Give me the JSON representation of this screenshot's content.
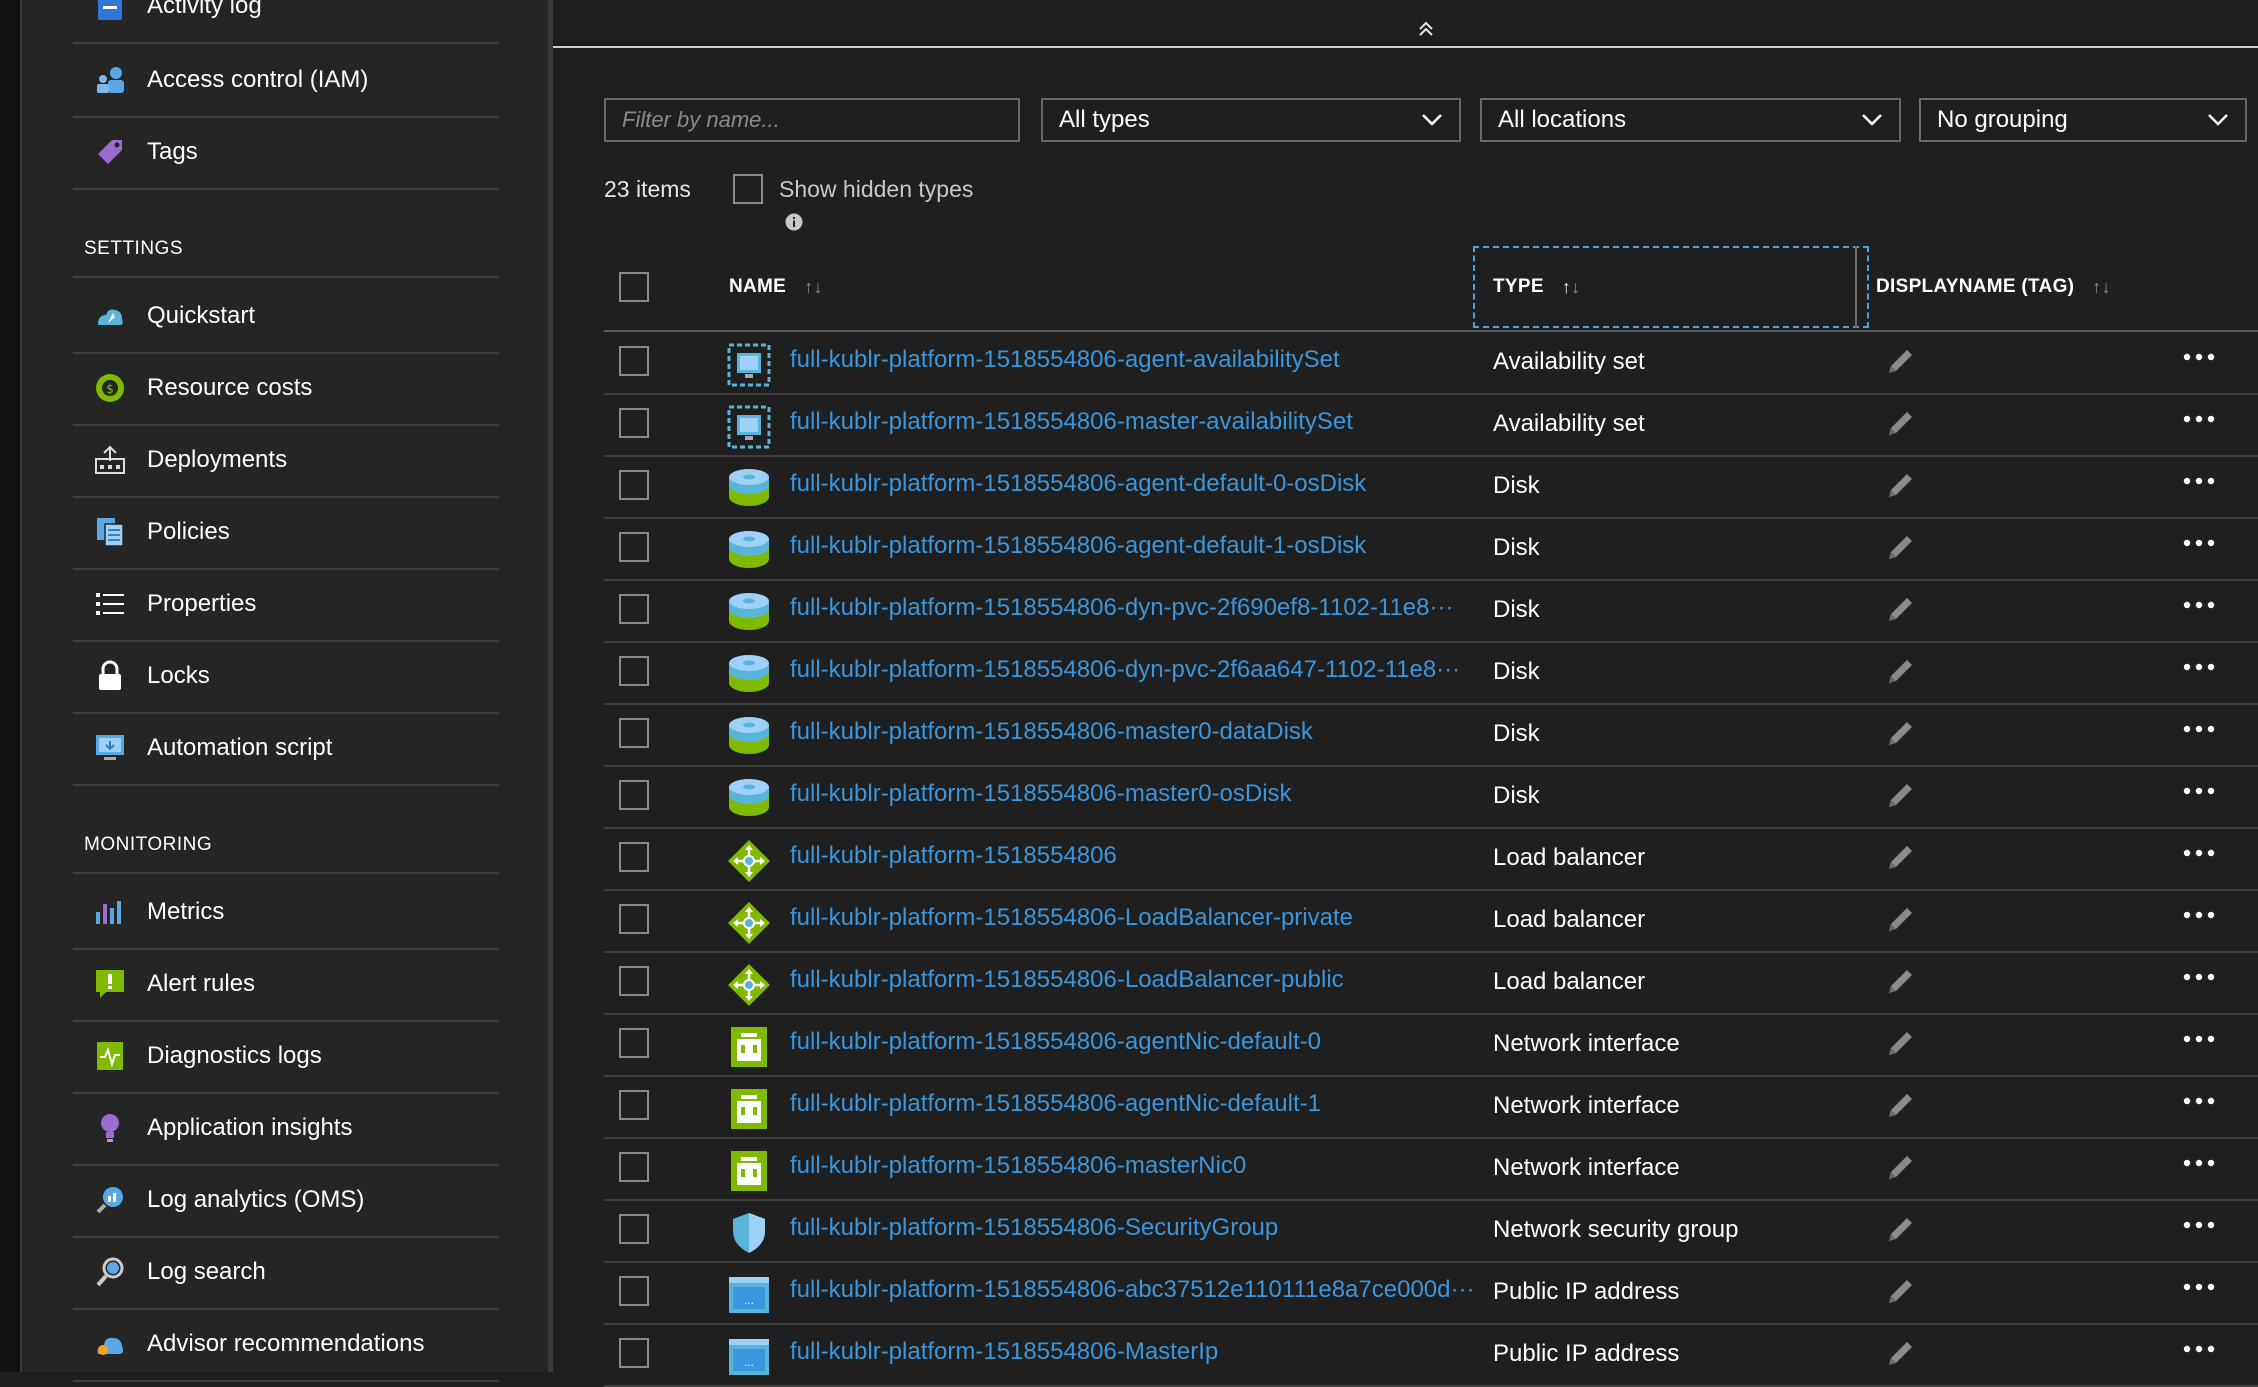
{
  "sidebar": {
    "items_top": [
      {
        "label": "Activity log",
        "icon": "activity-log-icon"
      },
      {
        "label": "Access control (IAM)",
        "icon": "access-control-icon"
      },
      {
        "label": "Tags",
        "icon": "tag-icon"
      }
    ],
    "settings_heading": "SETTINGS",
    "settings_items": [
      {
        "label": "Quickstart",
        "icon": "quickstart-icon"
      },
      {
        "label": "Resource costs",
        "icon": "resource-costs-icon"
      },
      {
        "label": "Deployments",
        "icon": "deployments-icon"
      },
      {
        "label": "Policies",
        "icon": "policies-icon"
      },
      {
        "label": "Properties",
        "icon": "properties-icon"
      },
      {
        "label": "Locks",
        "icon": "lock-icon"
      },
      {
        "label": "Automation script",
        "icon": "automation-script-icon"
      }
    ],
    "monitoring_heading": "MONITORING",
    "monitoring_items": [
      {
        "label": "Metrics",
        "icon": "metrics-icon"
      },
      {
        "label": "Alert rules",
        "icon": "alert-rules-icon"
      },
      {
        "label": "Diagnostics logs",
        "icon": "diagnostics-logs-icon"
      },
      {
        "label": "Application insights",
        "icon": "application-insights-icon"
      },
      {
        "label": "Log analytics (OMS)",
        "icon": "log-analytics-icon"
      },
      {
        "label": "Log search",
        "icon": "log-search-icon"
      },
      {
        "label": "Advisor recommendations",
        "icon": "advisor-icon"
      }
    ]
  },
  "filters": {
    "name_placeholder": "Filter by name...",
    "types": "All types",
    "locations": "All locations",
    "grouping": "No grouping"
  },
  "summary": {
    "count": "23 items",
    "show_hidden_label": "Show hidden types"
  },
  "table": {
    "columns": {
      "name": "NAME",
      "type": "TYPE",
      "displayname": "DISPLAYNAME (TAG)"
    },
    "rows": [
      {
        "name": "full-kublr-platform-1518554806-agent-availabilitySet",
        "type": "Availability set",
        "icon": "availability-set-icon"
      },
      {
        "name": "full-kublr-platform-1518554806-master-availabilitySet",
        "type": "Availability set",
        "icon": "availability-set-icon"
      },
      {
        "name": "full-kublr-platform-1518554806-agent-default-0-osDisk",
        "type": "Disk",
        "icon": "disk-icon"
      },
      {
        "name": "full-kublr-platform-1518554806-agent-default-1-osDisk",
        "type": "Disk",
        "icon": "disk-icon"
      },
      {
        "name": "full-kublr-platform-1518554806-dyn-pvc-2f690ef8-1102-11e8···",
        "type": "Disk",
        "icon": "disk-icon"
      },
      {
        "name": "full-kublr-platform-1518554806-dyn-pvc-2f6aa647-1102-11e8···",
        "type": "Disk",
        "icon": "disk-icon"
      },
      {
        "name": "full-kublr-platform-1518554806-master0-dataDisk",
        "type": "Disk",
        "icon": "disk-icon"
      },
      {
        "name": "full-kublr-platform-1518554806-master0-osDisk",
        "type": "Disk",
        "icon": "disk-icon"
      },
      {
        "name": "full-kublr-platform-1518554806",
        "type": "Load balancer",
        "icon": "load-balancer-icon"
      },
      {
        "name": "full-kublr-platform-1518554806-LoadBalancer-private",
        "type": "Load balancer",
        "icon": "load-balancer-icon"
      },
      {
        "name": "full-kublr-platform-1518554806-LoadBalancer-public",
        "type": "Load balancer",
        "icon": "load-balancer-icon"
      },
      {
        "name": "full-kublr-platform-1518554806-agentNic-default-0",
        "type": "Network interface",
        "icon": "network-interface-icon"
      },
      {
        "name": "full-kublr-platform-1518554806-agentNic-default-1",
        "type": "Network interface",
        "icon": "network-interface-icon"
      },
      {
        "name": "full-kublr-platform-1518554806-masterNic0",
        "type": "Network interface",
        "icon": "network-interface-icon"
      },
      {
        "name": "full-kublr-platform-1518554806-SecurityGroup",
        "type": "Network security group",
        "icon": "security-group-icon"
      },
      {
        "name": "full-kublr-platform-1518554806-abc37512e110111e8a7ce000d···",
        "type": "Public IP address",
        "icon": "public-ip-icon"
      },
      {
        "name": "full-kublr-platform-1518554806-MasterIp",
        "type": "Public IP address",
        "icon": "public-ip-icon"
      }
    ]
  },
  "colors": {
    "link": "#3a96dd",
    "background": "#1f1f1f",
    "sidebar": "#252526",
    "focus_border": "#4aa3df"
  }
}
